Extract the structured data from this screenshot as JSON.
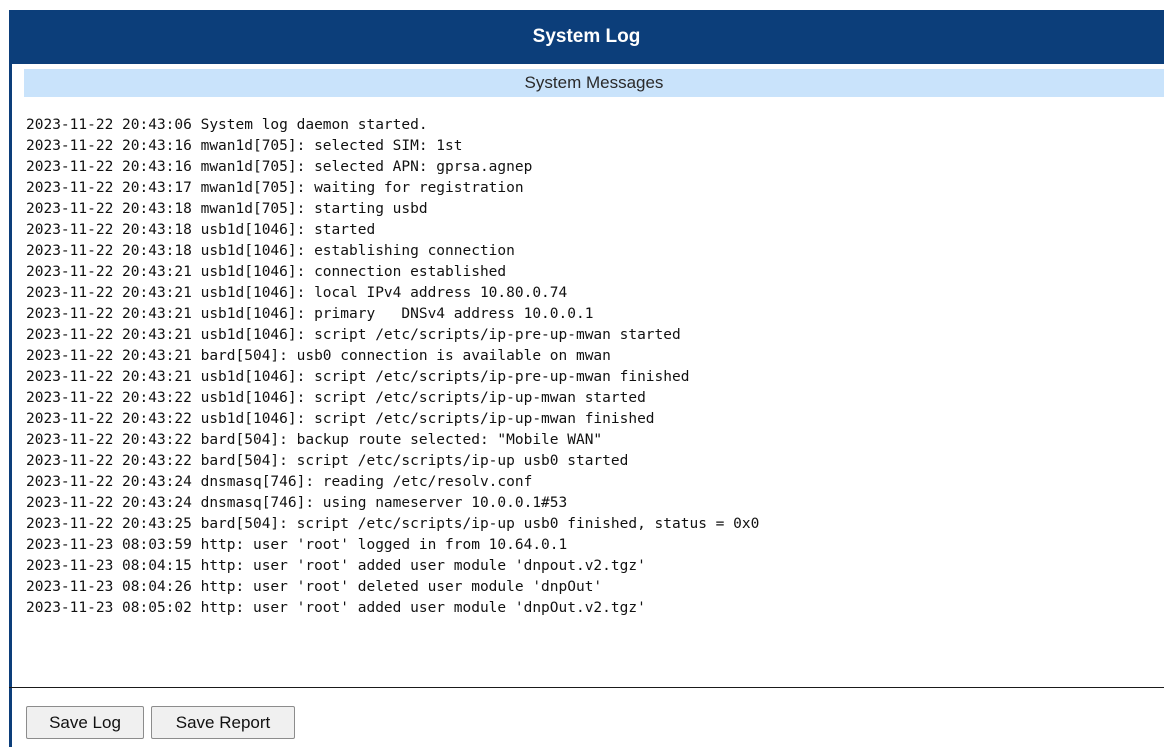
{
  "window": {
    "title": "System Log"
  },
  "section": {
    "header": "System Messages"
  },
  "log": {
    "lines": [
      "2023-11-22 20:43:06 System log daemon started.",
      "2023-11-22 20:43:16 mwan1d[705]: selected SIM: 1st",
      "2023-11-22 20:43:16 mwan1d[705]: selected APN: gprsa.agnep",
      "2023-11-22 20:43:17 mwan1d[705]: waiting for registration",
      "2023-11-22 20:43:18 mwan1d[705]: starting usbd",
      "2023-11-22 20:43:18 usb1d[1046]: started",
      "2023-11-22 20:43:18 usb1d[1046]: establishing connection",
      "2023-11-22 20:43:21 usb1d[1046]: connection established",
      "2023-11-22 20:43:21 usb1d[1046]: local IPv4 address 10.80.0.74",
      "2023-11-22 20:43:21 usb1d[1046]: primary   DNSv4 address 10.0.0.1",
      "2023-11-22 20:43:21 usb1d[1046]: script /etc/scripts/ip-pre-up-mwan started",
      "2023-11-22 20:43:21 bard[504]: usb0 connection is available on mwan",
      "2023-11-22 20:43:21 usb1d[1046]: script /etc/scripts/ip-pre-up-mwan finished",
      "2023-11-22 20:43:22 usb1d[1046]: script /etc/scripts/ip-up-mwan started",
      "2023-11-22 20:43:22 usb1d[1046]: script /etc/scripts/ip-up-mwan finished",
      "2023-11-22 20:43:22 bard[504]: backup route selected: \"Mobile WAN\"",
      "2023-11-22 20:43:22 bard[504]: script /etc/scripts/ip-up usb0 started",
      "2023-11-22 20:43:24 dnsmasq[746]: reading /etc/resolv.conf",
      "2023-11-22 20:43:24 dnsmasq[746]: using nameserver 10.0.0.1#53",
      "2023-11-22 20:43:25 bard[504]: script /etc/scripts/ip-up usb0 finished, status = 0x0",
      "2023-11-23 08:03:59 http: user 'root' logged in from 10.64.0.1",
      "2023-11-23 08:04:15 http: user 'root' added user module 'dnpout.v2.tgz'",
      "2023-11-23 08:04:26 http: user 'root' deleted user module 'dnpOut'",
      "2023-11-23 08:05:02 http: user 'root' added user module 'dnpOut.v2.tgz'"
    ]
  },
  "buttons": {
    "save_log": "Save Log",
    "save_report": "Save Report"
  },
  "colors": {
    "title_bar": "#0c3e7a",
    "section_header": "#c9e3fb"
  }
}
